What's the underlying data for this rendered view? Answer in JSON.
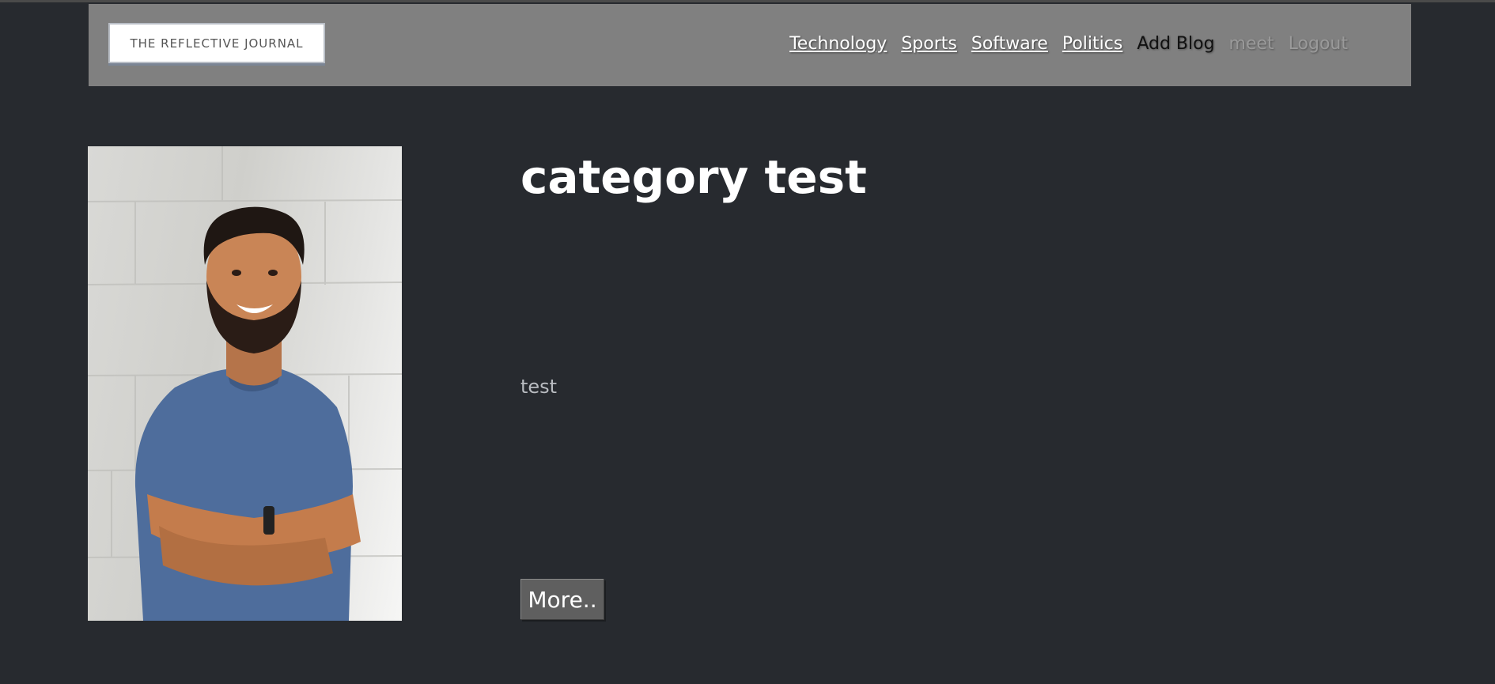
{
  "header": {
    "logo_text": "THE REFLECTIVE JOURNAL",
    "nav": [
      {
        "label": "Technology"
      },
      {
        "label": "Sports"
      },
      {
        "label": "Software"
      },
      {
        "label": "Politics"
      },
      {
        "label": "Add Blog"
      },
      {
        "label": "meet"
      },
      {
        "label": "Logout"
      }
    ]
  },
  "post": {
    "title": "category test",
    "body": "test",
    "more_label": "More.."
  },
  "colors": {
    "page_background": "#272a2f",
    "navbar_background": "#808080",
    "button_background": "#5f5f5f"
  }
}
